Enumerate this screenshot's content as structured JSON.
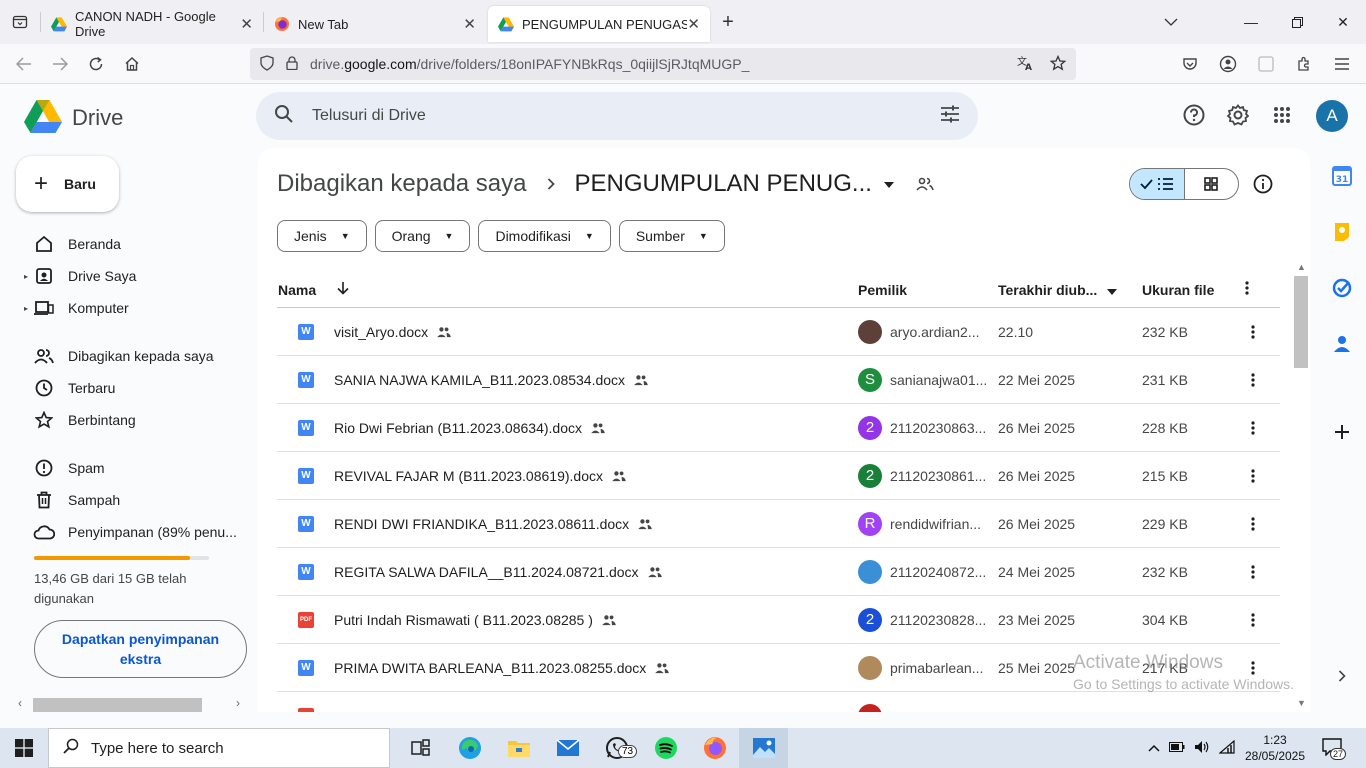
{
  "browser": {
    "tabs": [
      {
        "title": "CANON NADH - Google Drive",
        "active": false,
        "favicon": "drive-icon"
      },
      {
        "title": "New Tab",
        "active": false,
        "favicon": "firefox-icon"
      },
      {
        "title": "PENGUMPULAN PENUGASAN \\",
        "active": true,
        "favicon": "drive-icon"
      }
    ],
    "url_prefix": "drive.",
    "url_domain": "google.com",
    "url_path": "/drive/folders/18onIPAFYNBkRqs_0qiijlSjRJtqMUGP_"
  },
  "drive": {
    "logo_text": "Drive",
    "search_placeholder": "Telusuri di Drive",
    "avatar_letter": "A",
    "new_button": "Baru",
    "nav": [
      {
        "label": "Beranda",
        "icon": "home-icon"
      },
      {
        "label": "Drive Saya",
        "icon": "my-drive-icon"
      },
      {
        "label": "Komputer",
        "icon": "computer-icon"
      },
      {
        "label": "Dibagikan kepada saya",
        "icon": "shared-icon"
      },
      {
        "label": "Terbaru",
        "icon": "clock-icon"
      },
      {
        "label": "Berbintang",
        "icon": "star-icon"
      },
      {
        "label": "Spam",
        "icon": "spam-icon"
      },
      {
        "label": "Sampah",
        "icon": "trash-icon"
      },
      {
        "label": "Penyimpanan (89% penu...",
        "icon": "cloud-icon"
      }
    ],
    "storage_used_fraction": 0.89,
    "storage_text": "13,46 GB dari 15 GB telah digunakan",
    "get_storage_button": "Dapatkan penyimpanan ekstra",
    "breadcrumb_root": "Dibagikan kepada saya",
    "breadcrumb_current": "PENGUMPULAN PENUG...",
    "filters": [
      "Jenis",
      "Orang",
      "Dimodifikasi",
      "Sumber"
    ],
    "columns": {
      "name": "Nama",
      "owner": "Pemilik",
      "modified": "Terakhir diub...",
      "size": "Ukuran file"
    },
    "files": [
      {
        "name": "visit_Aryo.docx",
        "type": "docx",
        "owner": "aryo.ardian2...",
        "owner_avatar": "",
        "owner_color": "#5d4037",
        "modified": "22.10",
        "size": "232 KB"
      },
      {
        "name": "SANIA NAJWA KAMILA_B11.2023.08534.docx",
        "type": "docx",
        "owner": "sanianajwa01...",
        "owner_avatar": "S",
        "owner_color": "#1e8e3e",
        "modified": "22 Mei 2025",
        "size": "231 KB"
      },
      {
        "name": "Rio Dwi Febrian (B11.2023.08634).docx",
        "type": "docx",
        "owner": "21120230863...",
        "owner_avatar": "2",
        "owner_color": "#9334e6",
        "modified": "26 Mei 2025",
        "size": "228 KB"
      },
      {
        "name": "REVIVAL FAJAR M (B11.2023.08619).docx",
        "type": "docx",
        "owner": "21120230861...",
        "owner_avatar": "2",
        "owner_color": "#188038",
        "modified": "26 Mei 2025",
        "size": "215 KB"
      },
      {
        "name": "RENDI DWI FRIANDIKA_B11.2023.08611.docx",
        "type": "docx",
        "owner": "rendidwifrian...",
        "owner_avatar": "R",
        "owner_color": "#a142f4",
        "modified": "26 Mei 2025",
        "size": "229 KB"
      },
      {
        "name": "REGITA SALWA DAFILA__B11.2024.08721.docx",
        "type": "docx",
        "owner": "21120240872...",
        "owner_avatar": "",
        "owner_color": "#3a8fd6",
        "modified": "24 Mei 2025",
        "size": "232 KB"
      },
      {
        "name": "Putri Indah Rismawati ( B11.2023.08285 )",
        "type": "pdf",
        "owner": "21120230828...",
        "owner_avatar": "2",
        "owner_color": "#1a4fd6",
        "modified": "23 Mei 2025",
        "size": "304 KB"
      },
      {
        "name": "PRIMA DWITA BARLEANA_B11.2023.08255.docx",
        "type": "docx",
        "owner": "primabarlean...",
        "owner_avatar": "",
        "owner_color": "#b08a5a",
        "modified": "25 Mei 2025",
        "size": "217 KB"
      }
    ]
  },
  "watermark": {
    "line1": "Activate Windows",
    "line2": "Go to Settings to activate Windows."
  },
  "taskbar": {
    "search_placeholder": "Type here to search",
    "whatsapp_badge": "73",
    "time": "1:23",
    "date": "28/05/2025",
    "notification_count": "27"
  }
}
